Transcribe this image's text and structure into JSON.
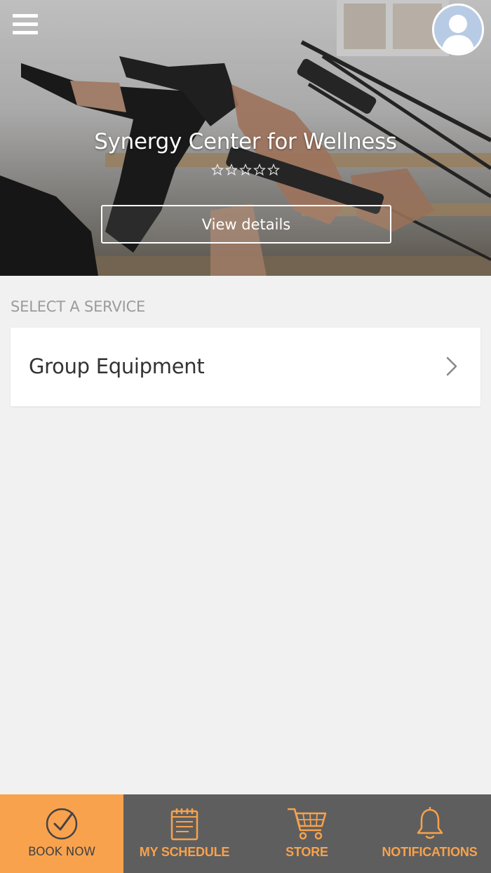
{
  "header": {
    "business_name": "Synergy Center for Wellness",
    "rating": {
      "stars": 0,
      "max": 5
    },
    "view_details_label": "View details",
    "menu_icon": "hamburger-menu-icon",
    "avatar_icon": "user-avatar-icon"
  },
  "services": {
    "heading": "SELECT A SERVICE",
    "items": [
      {
        "label": "Group Equipment",
        "icon": "chevron-right-icon"
      }
    ]
  },
  "tabbar": {
    "tabs": [
      {
        "label": "BOOK NOW",
        "icon": "checkmark-circle-icon",
        "active": true
      },
      {
        "label": "MY SCHEDULE",
        "icon": "calendar-icon",
        "active": false
      },
      {
        "label": "STORE",
        "icon": "shopping-cart-icon",
        "active": false
      },
      {
        "label": "NOTIFICATIONS",
        "icon": "bell-icon",
        "active": false
      }
    ]
  },
  "colors": {
    "accent": "#f9a24e",
    "tab_bar_background": "#5e5e5e",
    "page_background": "#f1f1f1",
    "heading_gray": "#9b9b9b"
  }
}
